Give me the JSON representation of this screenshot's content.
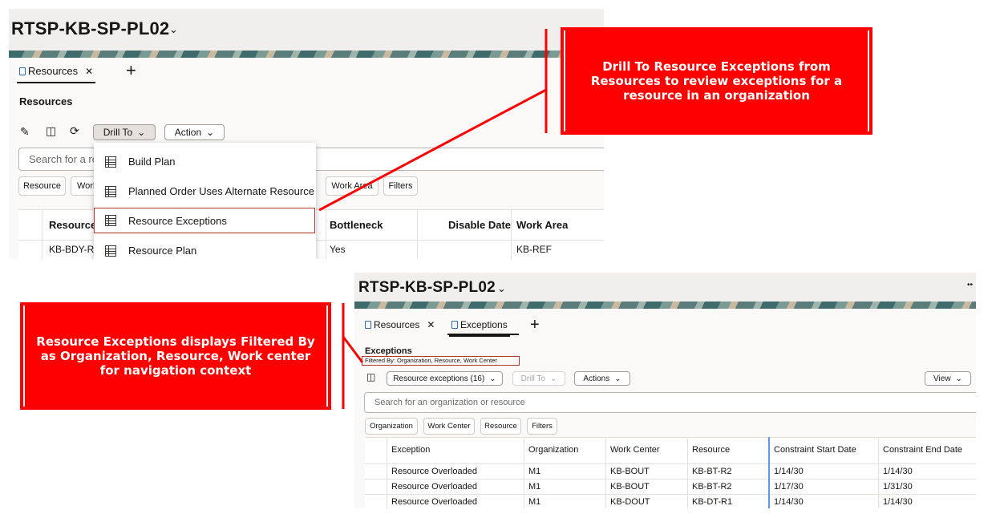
{
  "top": {
    "title": "RTSP-KB-SP-PL02",
    "tabs": [
      {
        "label": "Resources"
      }
    ],
    "page_heading": "Resources",
    "drill_to_label": "Drill To",
    "action_label": "Action",
    "search_placeholder": "Search for a re",
    "chips": [
      "Resource",
      "Work",
      "Work Area",
      "Filters"
    ],
    "drill_menu": [
      "Build Plan",
      "Planned Order Uses Alternate Resource",
      "Resource Exceptions",
      "Resource Plan"
    ],
    "columns": [
      "Resource",
      "Bottleneck",
      "Disable Date",
      "Work Area"
    ],
    "rows": [
      {
        "resource": "KB-BDY-R",
        "bottleneck": "Yes",
        "disable_date": "",
        "work_area": "KB-REF"
      }
    ]
  },
  "bottom": {
    "title": "RTSP-KB-SP-PL02",
    "more": "••",
    "tabs": [
      {
        "label": "Resources"
      },
      {
        "label": "Exceptions"
      }
    ],
    "page_heading": "Exceptions",
    "filtered_by": "Filtered By: Organization, Resource, Work Center",
    "exceptions_dropdown": "Resource exceptions (16)",
    "drill_to_label": "Drill To",
    "actions_label": "Actions",
    "view_label": "View",
    "search_placeholder": "Search for an organization or resource",
    "chips": [
      "Organization",
      "Work Center",
      "Resource",
      "Filters"
    ],
    "columns": [
      "Exception",
      "Organization",
      "Work Center",
      "Resource",
      "Constraint Start Date",
      "Constraint End Date"
    ],
    "rows": [
      [
        "Resource Overloaded",
        "M1",
        "KB-BOUT",
        "KB-BT-R2",
        "1/14/30",
        "1/14/30"
      ],
      [
        "Resource Overloaded",
        "M1",
        "KB-BOUT",
        "KB-BT-R2",
        "1/17/30",
        "1/31/30"
      ],
      [
        "Resource Overloaded",
        "M1",
        "KB-DOUT",
        "KB-DT-R1",
        "1/14/30",
        "1/14/30"
      ]
    ]
  },
  "callouts": {
    "drill": "Drill To Resource Exceptions from Resources to review exceptions for a resource in an organization",
    "filtered": "Resource Exceptions displays Filtered By as Organization, Resource, Work center for navigation context"
  },
  "colors": {
    "callout": "#ff0000",
    "highlight": "#b33a2b"
  },
  "icons": [
    "edit-icon",
    "note-icon",
    "refresh-icon",
    "chevron-down-icon",
    "close-icon",
    "plus-icon",
    "table-icon",
    "document-icon"
  ]
}
